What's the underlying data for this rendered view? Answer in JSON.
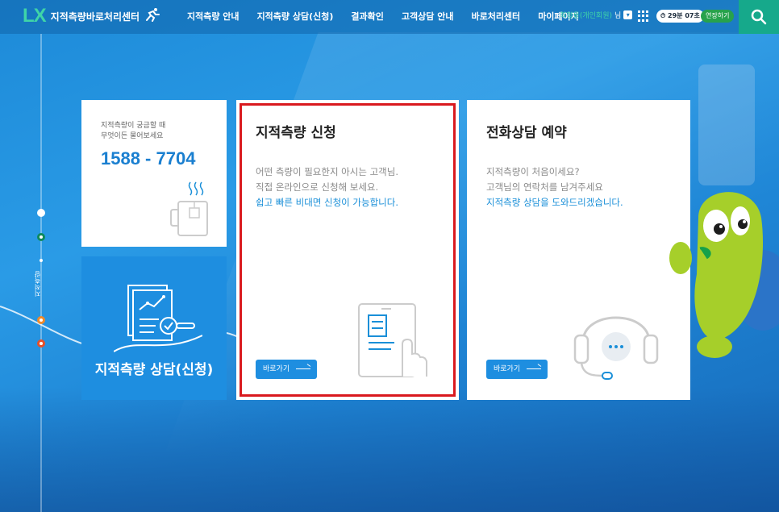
{
  "header": {
    "logo_mark": "LX",
    "logo_text": "지적측량바로처리센터",
    "nav": [
      "지적측량 안내",
      "지적측량 상담(신청)",
      "결과확인",
      "고객상담 안내",
      "바로처리센터",
      "마이페이지"
    ],
    "user_name": "최형용(개인회원)",
    "user_suffix": "님",
    "session_timer": "29분 07초",
    "extend_label": "연장하기"
  },
  "timeline": {
    "label": "지적측량"
  },
  "phone_card": {
    "desc_line1": "지적측량이 궁금할 때",
    "desc_line2": "무엇이든 물어보세요",
    "number": "1588 - 7704"
  },
  "consult_card": {
    "title": "지적측량 상담(신청)"
  },
  "apply_card": {
    "title": "지적측량 신청",
    "desc_line1": "어떤 측량이 필요한지 아시는 고객님.",
    "desc_line2": "직접 온라인으로 신청해 보세요.",
    "desc_highlight": "쉽고 빠른 비대면 신청이 가능합니다.",
    "button": "바로가기"
  },
  "phone_consult_card": {
    "title": "전화상담 예약",
    "desc_line1": "지적측량이 처음이세요?",
    "desc_line2": "고객님의 연락처를 남겨주세요",
    "desc_highlight": "지적측량 상담을 도와드리겠습니다.",
    "button": "바로가기"
  },
  "colors": {
    "primary": "#1e8ee0",
    "accent_green": "#16a98b",
    "highlight_border": "#d9191e"
  }
}
